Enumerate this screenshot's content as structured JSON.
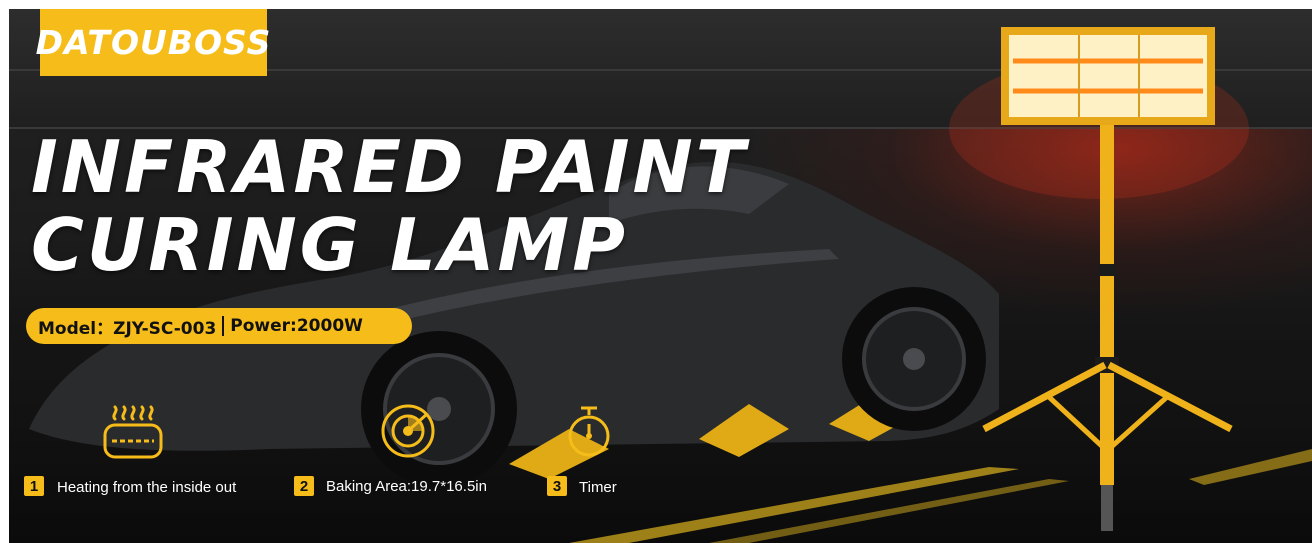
{
  "brand": {
    "logo_text": "DATOUBOSS"
  },
  "headline": {
    "line1": "INFRARED PAINT",
    "line2": "CURING LAMP"
  },
  "specs": {
    "model": "Model：ZJY-SC-003",
    "power": "Power:2000W"
  },
  "features": [
    {
      "number": "1",
      "label": "Heating from the inside out",
      "icon": "heater-icon"
    },
    {
      "number": "2",
      "label": "Baking Area:19.7*16.5in",
      "icon": "radar-target-icon"
    },
    {
      "number": "3",
      "label": "Timer",
      "icon": "stopwatch-icon"
    }
  ],
  "colors": {
    "accent": "#f6bd1a",
    "background": "#1a1a1a",
    "text": "#ffffff"
  }
}
